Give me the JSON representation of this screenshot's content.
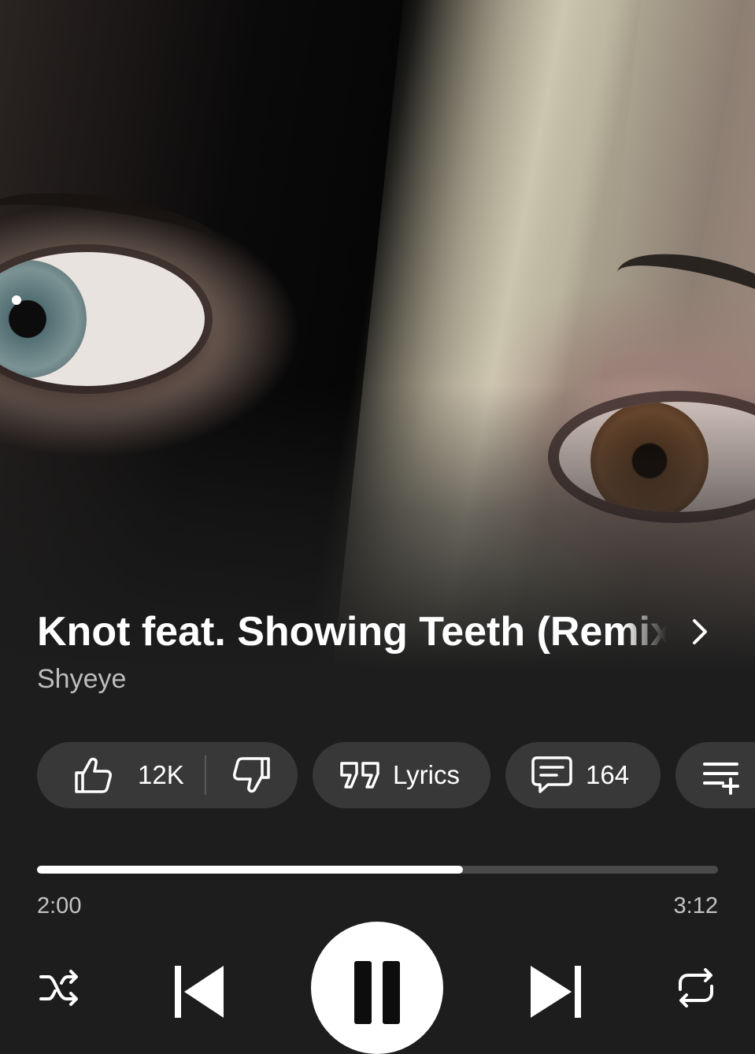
{
  "track": {
    "title": "Knot feat. Showing Teeth (Remix)",
    "artist": "Shyeye"
  },
  "actions": {
    "like_count": "12K",
    "lyrics_label": "Lyrics",
    "comment_count": "164"
  },
  "playback": {
    "current_time": "2:00",
    "total_time": "3:12",
    "progress_fraction": 0.625,
    "state": "playing"
  },
  "icons": {
    "title_more": "chevron-right-icon",
    "like": "thumbs-up-icon",
    "dislike": "thumbs-down-icon",
    "lyrics": "quote-icon",
    "comments": "comment-icon",
    "save": "playlist-add-icon",
    "shuffle": "shuffle-icon",
    "previous": "skip-previous-icon",
    "play_pause": "pause-icon",
    "next": "skip-next-icon",
    "repeat": "repeat-icon"
  },
  "colors": {
    "background": "#1d1d1d",
    "chip": "#383838",
    "progress_fill": "#ffffff",
    "progress_track": "#4a4a4a",
    "secondary_text": "#bdbdbd"
  }
}
